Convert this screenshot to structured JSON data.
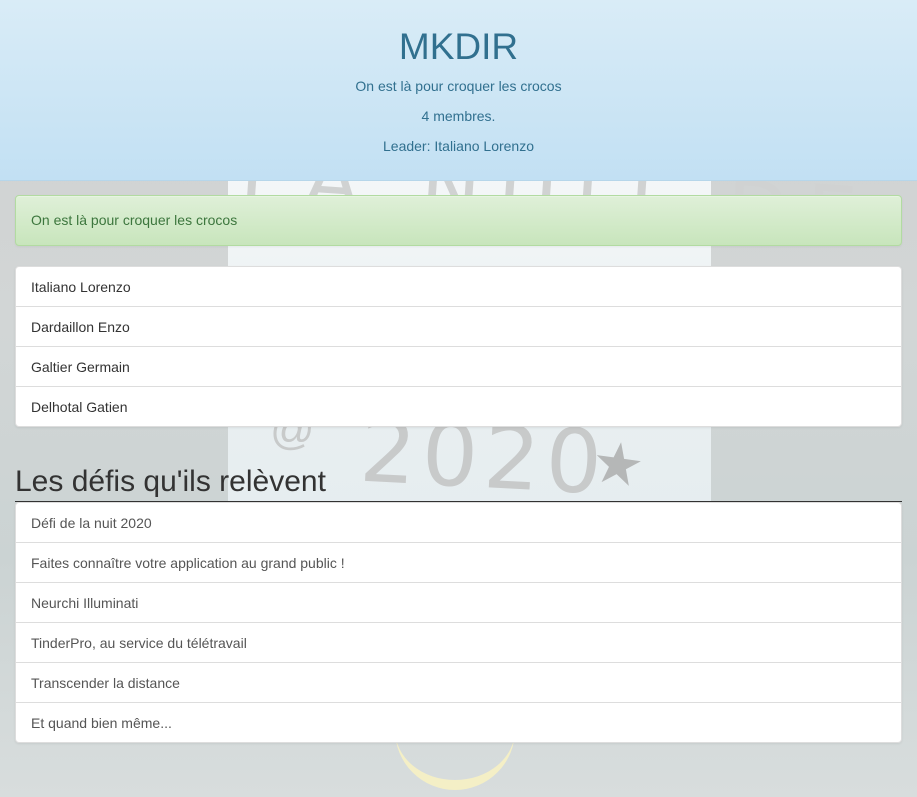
{
  "header": {
    "team_name": "MKDIR",
    "description": "On est là pour croquer les crocos",
    "member_count": "4 membres.",
    "leader": "Leader: Italiano Lorenzo"
  },
  "alert": {
    "message": "On est là pour croquer les crocos"
  },
  "members": [
    "Italiano Lorenzo",
    "Dardaillon Enzo",
    "Galtier Germain",
    "Delhotal Gatien"
  ],
  "challenges_section": {
    "title": "Les défis qu'ils relèvent",
    "items": [
      "Défi de la nuit 2020",
      "Faites connaître votre application au grand public !",
      "Neurchi Illuminati",
      "TinderPro, au service du télétravail",
      "Transcender la distance",
      "Et quand bien même..."
    ]
  },
  "background_photo": {
    "lightbox_top_text": "LA NUIT DE",
    "lightbox_year": "2020"
  },
  "colors": {
    "header_text": "#31708f",
    "header_bg": "#c2e0f3",
    "alert_text": "#3c763d",
    "alert_bg": "#dff0d8"
  }
}
